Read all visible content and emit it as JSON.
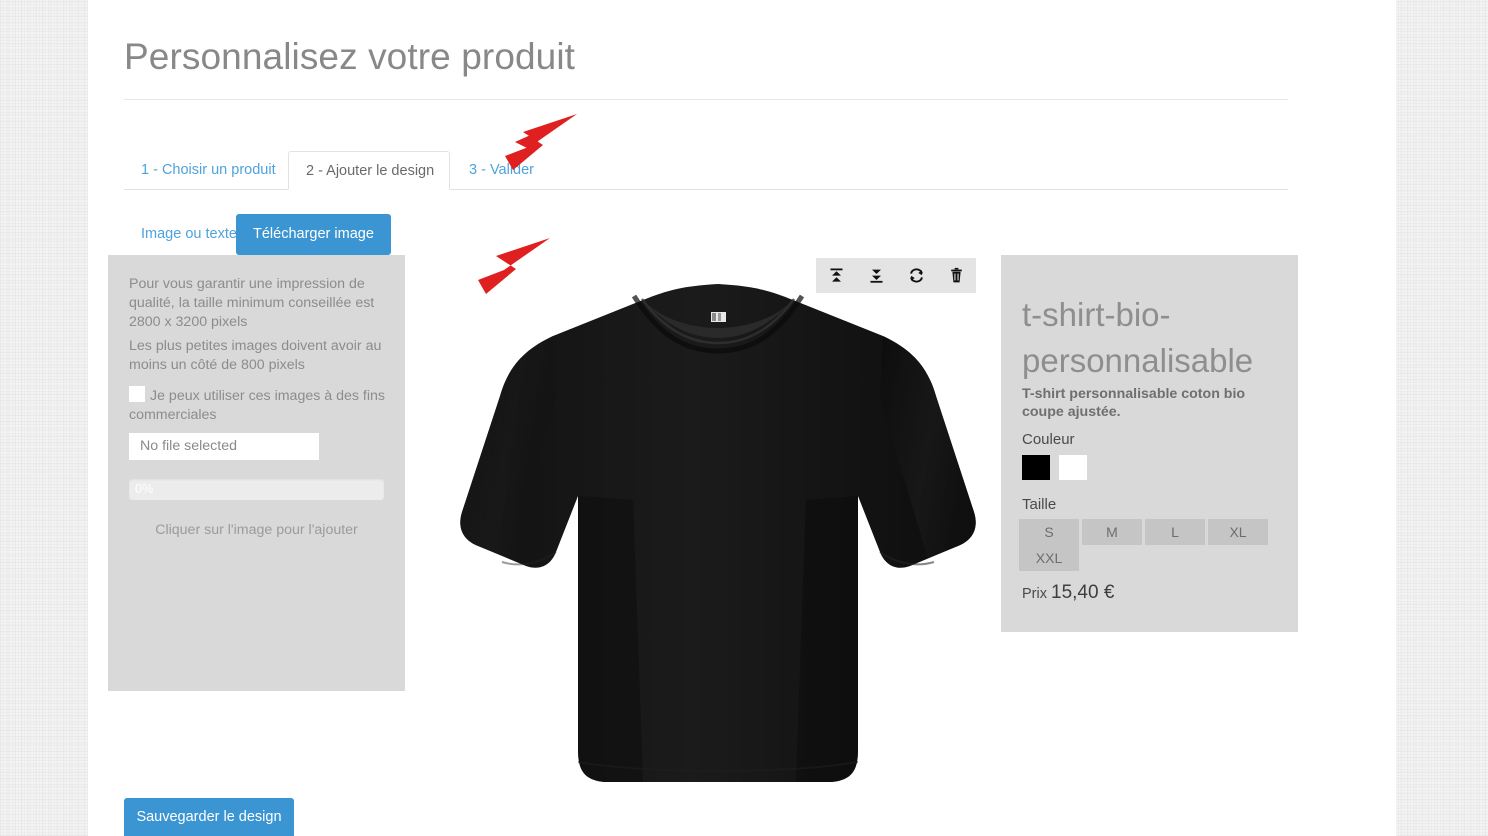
{
  "page": {
    "title": "Personnalisez votre produit"
  },
  "wizard": {
    "tabs": [
      {
        "label": "1 - Choisir un produit",
        "active": false
      },
      {
        "label": "2 - Ajouter le design",
        "active": true
      },
      {
        "label": "3 - Valider",
        "active": false
      }
    ]
  },
  "design_tabs": [
    {
      "label": "Image ou texte",
      "active": false
    },
    {
      "label": "Télécharger image",
      "active": true
    }
  ],
  "upload_panel": {
    "quality_note": "Pour vous garantir une impression de qualité, la taille minimum conseillée est 2800 x 3200 pixels",
    "min_size_note": "Les plus petites images doivent avoir au moins un côté de 800 pixels",
    "commercial_checkbox_label": "Je peux utiliser ces images à des fins commerciales",
    "commercial_checkbox_checked": false,
    "file_input_value": "No file selected",
    "progress_label": "0%",
    "progress_percent": 0,
    "click_hint": "Cliquer sur l'image pour l'ajouter"
  },
  "design_toolbar": {
    "buttons": [
      {
        "icon": "bring-to-front-icon",
        "title": "Mettre au premier plan"
      },
      {
        "icon": "send-to-back-icon",
        "title": "Mettre à l'arrière-plan"
      },
      {
        "icon": "flip-icon",
        "title": "Retourner"
      },
      {
        "icon": "trash-icon",
        "title": "Supprimer"
      }
    ]
  },
  "product": {
    "name": "t-shirt-bio-personnalisable",
    "description": "T-shirt personnalisable coton bio coupe ajustée.",
    "color_label": "Couleur",
    "colors": [
      {
        "name": "Noir",
        "hex": "#000000",
        "selected": true
      },
      {
        "name": "Blanc",
        "hex": "#ffffff",
        "selected": false
      }
    ],
    "size_label": "Taille",
    "sizes": [
      "S",
      "XXL",
      "M",
      "L",
      "XL"
    ],
    "price_label": "Prix",
    "price_value": "15,40 €",
    "preview_color": "#151515"
  },
  "actions": {
    "save_label": "Sauvegarder le design"
  },
  "annotations": {
    "arrow_color": "#e02020",
    "arrows": [
      {
        "name": "arrow-pointing-to-active-tab"
      },
      {
        "name": "arrow-pointing-to-upload-button"
      }
    ]
  }
}
